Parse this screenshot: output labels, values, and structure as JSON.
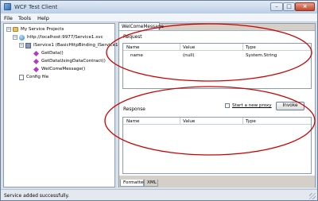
{
  "window": {
    "title": "WCF Test Client"
  },
  "menu": [
    "File",
    "Tools",
    "Help"
  ],
  "tree": {
    "root": "My Service Projects",
    "endpoint": "http://localhost:9977/Service1.svc",
    "contract": "IService1 (BasicHttpBinding_IService1)",
    "methods": [
      "GetData()",
      "GetDataUsingDataContract()",
      "WelComeMessage()"
    ],
    "config": "Config file"
  },
  "document_tab": "WelComeMessage",
  "request": {
    "label": "Request",
    "columns": [
      "Name",
      "Value",
      "Type"
    ],
    "rows": [
      {
        "name": "name",
        "value": "(null)",
        "type": "System.String"
      }
    ]
  },
  "response": {
    "label": "Response",
    "columns": [
      "Name",
      "Value",
      "Type"
    ],
    "proxy_label": "Start a new proxy",
    "invoke_label": "Invoke"
  },
  "bottom_tabs": [
    "Formatted",
    "XML"
  ],
  "status": "Service added successfully.",
  "annotation_color": "#cc0000"
}
